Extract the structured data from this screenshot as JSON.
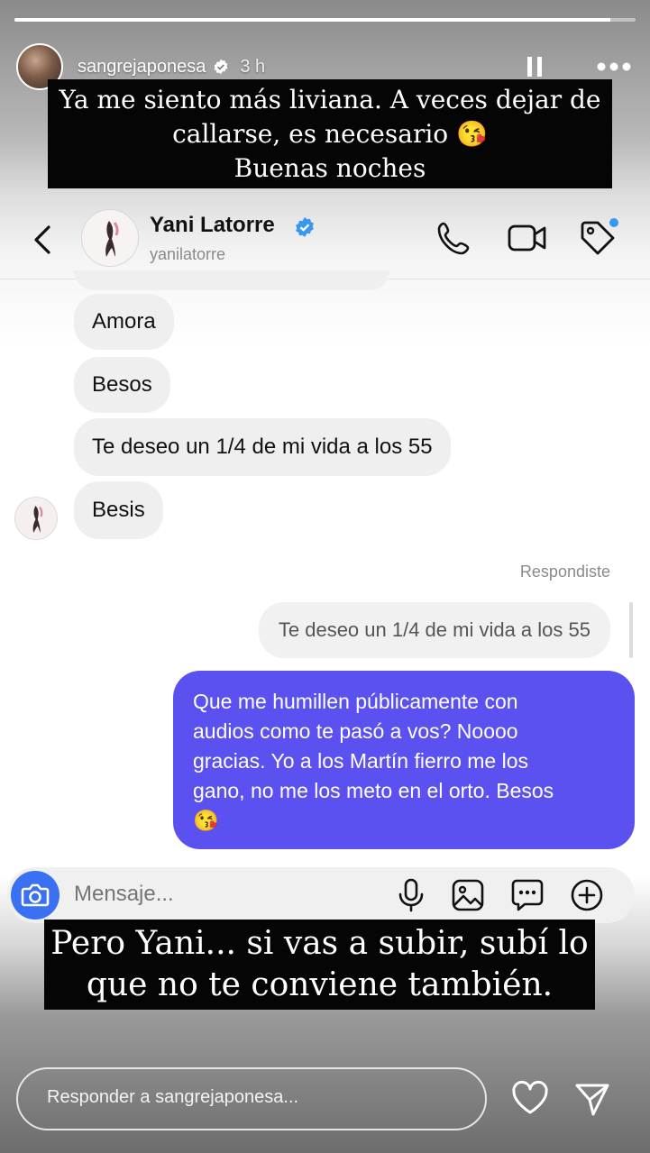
{
  "story": {
    "username": "sangrejaponesa",
    "time": "3 h",
    "progress": 0.96,
    "caption_top": [
      "Ya me siento más liviana. A veces dejar de",
      "callarse, es necesario 😘",
      "Buenas noches"
    ],
    "caption_bottom": [
      "Pero Yani... si vas a subir, subí lo",
      "que no te conviene también."
    ],
    "reply_placeholder": "Responder a sangrejaponesa...",
    "icons": [
      "pause-icon",
      "more-icon",
      "heart-icon",
      "send-icon"
    ]
  },
  "dm": {
    "name": "Yani Latorre",
    "handle": "yanilatorre",
    "icons": [
      "back-icon",
      "verified-icon",
      "call-icon",
      "video-icon",
      "tag-icon"
    ],
    "accent": "#3897f0"
  },
  "messages": {
    "received": [
      "Amora",
      "Besos",
      "Te deseo un 1/4 de mi vida a los 55",
      "Besis"
    ],
    "replied_label": "Respondiste",
    "quoted": "Te deseo un 1/4 de mi vida a los 55",
    "sent_lines": [
      "Que me humillen públicamente con",
      "audios como te pasó a vos? Noooo",
      "gracias. Yo a los Martín fierro me los",
      "gano, no me los meto en el orto. Besos",
      "😘"
    ],
    "sent_color": "#5b51f0"
  },
  "composer": {
    "placeholder": "Mensaje...",
    "icons": [
      "camera-icon",
      "mic-icon",
      "gallery-icon",
      "sticker-icon",
      "plus-icon"
    ]
  }
}
